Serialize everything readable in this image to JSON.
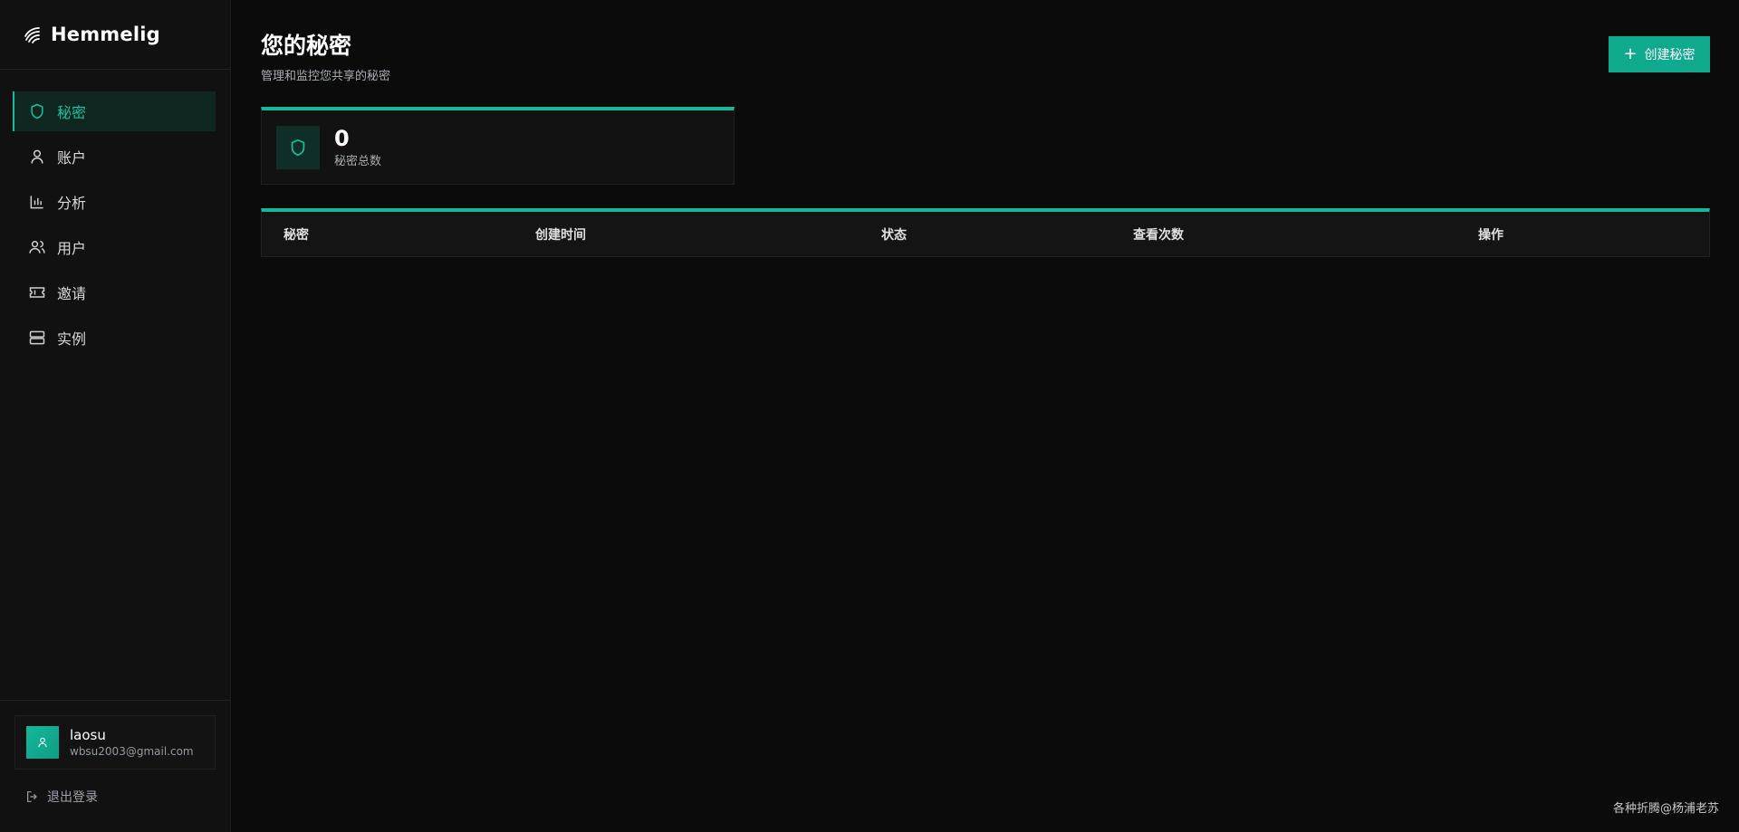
{
  "app": {
    "brand": "Hemmelig"
  },
  "sidebar": {
    "items": [
      {
        "label": "秘密",
        "icon": "shield-icon",
        "active": true
      },
      {
        "label": "账户",
        "icon": "user-icon",
        "active": false
      },
      {
        "label": "分析",
        "icon": "bar-chart-icon",
        "active": false
      },
      {
        "label": "用户",
        "icon": "users-icon",
        "active": false
      },
      {
        "label": "邀请",
        "icon": "ticket-icon",
        "active": false
      },
      {
        "label": "实例",
        "icon": "server-icon",
        "active": false
      }
    ]
  },
  "user": {
    "name": "laosu",
    "email": "wbsu2003@gmail.com"
  },
  "logout_label": "退出登录",
  "header": {
    "title": "您的秘密",
    "subtitle": "管理和监控您共享的秘密",
    "create_button": "创建秘密"
  },
  "stats": {
    "value": "0",
    "label": "秘密总数"
  },
  "table": {
    "columns": [
      "秘密",
      "创建时间",
      "状态",
      "查看次数",
      "操作"
    ],
    "rows": []
  },
  "watermark": "各种折腾@杨浦老苏",
  "colors": {
    "accent": "#14b89a",
    "background": "#0b0b0b",
    "sidebar": "#111111"
  }
}
